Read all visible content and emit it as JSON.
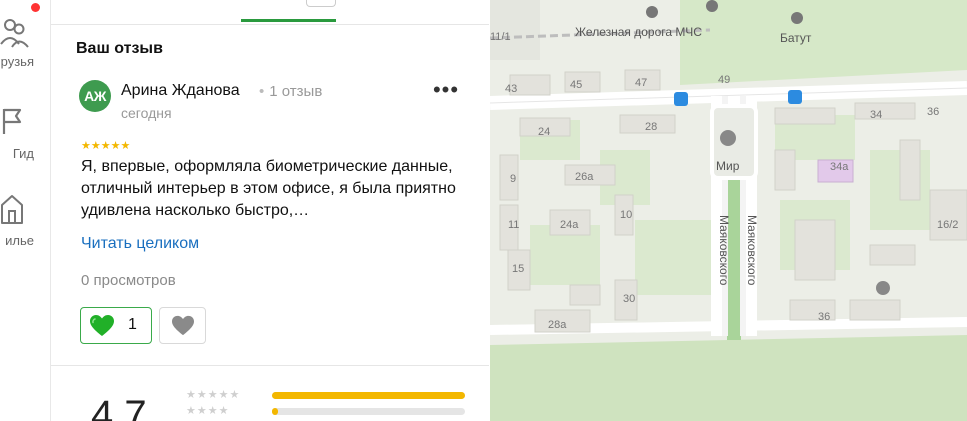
{
  "rail": {
    "items": [
      {
        "label": "рузья",
        "icon": "friends-icon"
      },
      {
        "label": "Гид",
        "icon": "guide-flag-icon"
      },
      {
        "label": "илье",
        "icon": "housing-icon"
      }
    ]
  },
  "review": {
    "section_title": "Ваш отзыв",
    "avatar_initials": "АЖ",
    "author_name": "Арина Жданова",
    "review_count": "1 отзыв",
    "date": "сегодня",
    "more_label": "•••",
    "stars": "★★★★★",
    "text": "Я, впервые, оформляла биометрические данные, отличный интерьер в этом офисе, я была приятно удивлена насколько быстро,…",
    "read_more": "Читать целиком",
    "views": "0 просмотров",
    "likes": "1"
  },
  "rating": {
    "value": "4,7",
    "rows": [
      {
        "stars": "★★★★★",
        "fill": 1.0
      },
      {
        "stars": "★★★★",
        "fill": 0.03
      }
    ]
  },
  "colors": {
    "accent_green": "#2a9a3e",
    "star_yellow": "#f3b700",
    "link_blue": "#1a6fbf",
    "map_road_blue": "#2c8be0"
  },
  "map": {
    "labels": {
      "railway": "Железная дорога МЧС",
      "batut": "Батут",
      "mir": "Мир",
      "street_1": "Маяковского",
      "street_2": "Маяковского"
    },
    "house_numbers": [
      "43",
      "45",
      "47",
      "49",
      "24",
      "28",
      "34",
      "36",
      "9",
      "26а",
      "34а",
      "11",
      "24а",
      "10",
      "16/2",
      "15",
      "30",
      "28а",
      "36",
      "11/1"
    ]
  }
}
